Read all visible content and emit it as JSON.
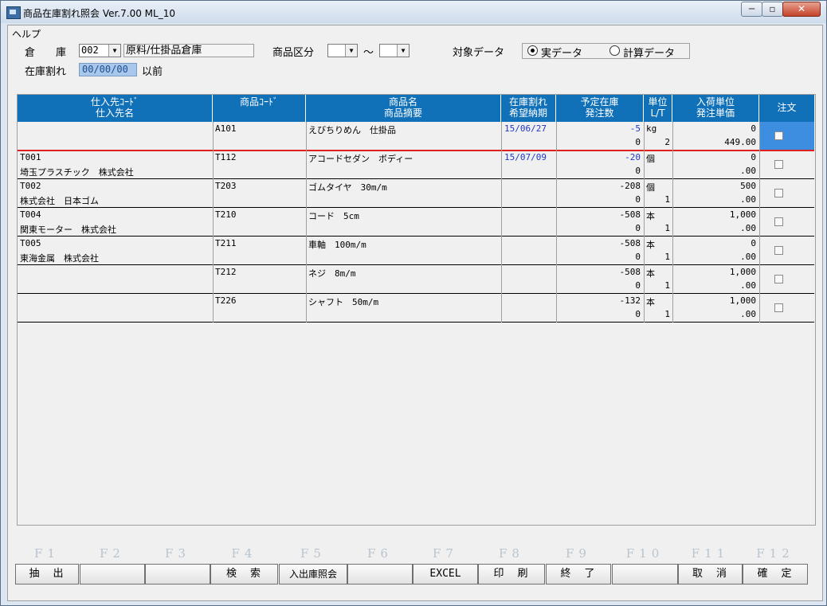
{
  "window": {
    "title": "商品在庫割れ照会 Ver.7.00 ML_10"
  },
  "menu": {
    "help": "ヘルプ"
  },
  "filters": {
    "warehouse_label": "倉　　庫",
    "warehouse_code": "002",
    "warehouse_name": "原料/仕掛品倉庫",
    "category_label": "商品区分",
    "tilde": "～",
    "target_label": "対象データ",
    "radio_actual": "実データ",
    "radio_calc": "計算データ",
    "stockout_label": "在庫割れ",
    "stockout_date": "00/00/00",
    "before_label": "以前"
  },
  "headers": {
    "supplier_code": "仕入先ｺｰﾄﾞ",
    "supplier_name": "仕入先名",
    "product_code": "商品ｺｰﾄﾞ",
    "product_name": "商品名",
    "product_desc": "商品摘要",
    "stockout": "在庫割れ",
    "desired_date": "希望納期",
    "planned_stock": "予定在庫",
    "order_qty": "発注数",
    "unit": "単位",
    "lt": "L/T",
    "receive_unit": "入荷単位",
    "order_price": "発注単価",
    "order": "注文"
  },
  "rows": [
    {
      "supplier_code": "",
      "supplier_name": "",
      "code": "A101",
      "name": "えびちりめん　仕掛品",
      "desc": "",
      "stockout_date": "15/06/27",
      "planned": "-5",
      "order_qty": "0",
      "unit": "kg",
      "lt": "2",
      "recv_unit": "0",
      "price": "449.00"
    },
    {
      "supplier_code": "T001",
      "supplier_name": "埼玉プラスチック　株式会社",
      "code": "T112",
      "name": "アコードセダン　ボディー",
      "desc": "",
      "stockout_date": "15/07/09",
      "planned": "-20",
      "order_qty": "0",
      "unit": "個",
      "lt": "",
      "recv_unit": "0",
      "price": ".00"
    },
    {
      "supplier_code": "T002",
      "supplier_name": "株式会社　日本ゴム",
      "code": "T203",
      "name": "ゴムタイヤ　30m/m",
      "desc": "",
      "stockout_date": "",
      "planned": "-208",
      "order_qty": "0",
      "unit": "個",
      "lt": "1",
      "recv_unit": "500",
      "price": ".00"
    },
    {
      "supplier_code": "T004",
      "supplier_name": "関東モーター　株式会社",
      "code": "T210",
      "name": "コード　5cm",
      "desc": "",
      "stockout_date": "",
      "planned": "-508",
      "order_qty": "0",
      "unit": "本",
      "lt": "1",
      "recv_unit": "1,000",
      "price": ".00"
    },
    {
      "supplier_code": "T005",
      "supplier_name": "東海金属　株式会社",
      "code": "T211",
      "name": "車軸　100m/m",
      "desc": "",
      "stockout_date": "",
      "planned": "-508",
      "order_qty": "0",
      "unit": "本",
      "lt": "1",
      "recv_unit": "0",
      "price": ".00"
    },
    {
      "supplier_code": "",
      "supplier_name": "",
      "code": "T212",
      "name": "ネジ　8m/m",
      "desc": "",
      "stockout_date": "",
      "planned": "-508",
      "order_qty": "0",
      "unit": "本",
      "lt": "1",
      "recv_unit": "1,000",
      "price": ".00"
    },
    {
      "supplier_code": "",
      "supplier_name": "",
      "code": "T226",
      "name": "シャフト　50m/m",
      "desc": "",
      "stockout_date": "",
      "planned": "-132",
      "order_qty": "0",
      "unit": "本",
      "lt": "1",
      "recv_unit": "1,000",
      "price": ".00"
    }
  ],
  "fkeys": [
    {
      "key": "F1",
      "label": "抽　出"
    },
    {
      "key": "F2",
      "label": ""
    },
    {
      "key": "F3",
      "label": ""
    },
    {
      "key": "F4",
      "label": "検　索"
    },
    {
      "key": "F5",
      "label": "入出庫照会"
    },
    {
      "key": "F6",
      "label": ""
    },
    {
      "key": "F7",
      "label": "EXCEL"
    },
    {
      "key": "F8",
      "label": "印　刷"
    },
    {
      "key": "F9",
      "label": "終　了"
    },
    {
      "key": "F10",
      "label": ""
    },
    {
      "key": "F11",
      "label": "取　消"
    },
    {
      "key": "F12",
      "label": "確　定"
    }
  ],
  "colors": {
    "header_bg": "#1070b8",
    "selected_cell": "#3d8ee0",
    "blue_text": "#1f38c8",
    "current_row_line": "#e02020"
  }
}
